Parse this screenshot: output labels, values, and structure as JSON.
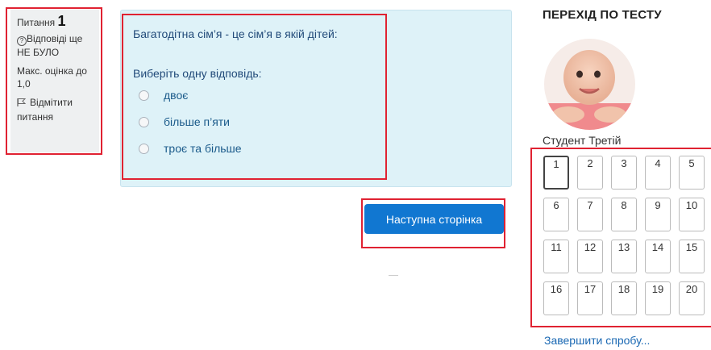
{
  "question_info": {
    "label": "Питання",
    "number": "1",
    "status": "Відповіді ще НЕ БУЛО",
    "max_grade": "Макс. оцінка до 1,0",
    "flag": "Відмітити питання"
  },
  "question": {
    "text": "Багатодітна сім’я - це сім’я в якій дітей:",
    "prompt": "Виберіть одну відповідь:",
    "options": [
      "двоє",
      "більше п’яти",
      "троє та більше"
    ]
  },
  "next_button": "Наступна сторінка",
  "navigation": {
    "title": "ПЕРЕХІД ПО ТЕСТУ",
    "user_name": "Студент Третій",
    "current": 1,
    "buttons": [
      "1",
      "2",
      "3",
      "4",
      "5",
      "6",
      "7",
      "8",
      "9",
      "10",
      "11",
      "12",
      "13",
      "14",
      "15",
      "16",
      "17",
      "18",
      "19",
      "20"
    ],
    "finish_link": "Завершити спробу..."
  },
  "colors": {
    "accent": "#1177d1",
    "highlight_frame": "#e02232",
    "question_bg": "#def2f8"
  }
}
